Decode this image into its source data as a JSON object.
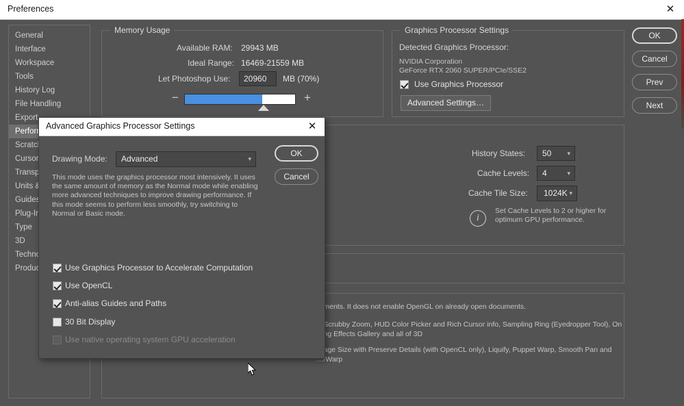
{
  "window": {
    "title": "Preferences",
    "close_icon": "close-icon",
    "close_glyph": "✕"
  },
  "sidebar": {
    "items": [
      {
        "label": "General",
        "selected": false
      },
      {
        "label": "Interface",
        "selected": false
      },
      {
        "label": "Workspace",
        "selected": false
      },
      {
        "label": "Tools",
        "selected": false
      },
      {
        "label": "History Log",
        "selected": false
      },
      {
        "label": "File Handling",
        "selected": false
      },
      {
        "label": "Export",
        "selected": false
      },
      {
        "label": "Performance",
        "selected": true
      },
      {
        "label": "Scratch Disks",
        "selected": false
      },
      {
        "label": "Cursors",
        "selected": false
      },
      {
        "label": "Transparency & Gamut",
        "selected": false
      },
      {
        "label": "Units & Rulers",
        "selected": false
      },
      {
        "label": "Guides, Grid & Slices",
        "selected": false
      },
      {
        "label": "Plug-Ins",
        "selected": false
      },
      {
        "label": "Type",
        "selected": false
      },
      {
        "label": "3D",
        "selected": false
      },
      {
        "label": "Technology Previews",
        "selected": false
      },
      {
        "label": "Product Improvement",
        "selected": false
      }
    ]
  },
  "memory_usage": {
    "group_title": "Memory Usage",
    "available_ram_label": "Available RAM:",
    "available_ram_value": "29943 MB",
    "ideal_range_label": "Ideal Range:",
    "ideal_range_value": "16469-21559 MB",
    "let_use_label": "Let Photoshop Use:",
    "let_use_value": "20960",
    "let_use_suffix": "MB (70%)",
    "slider_minus": "−",
    "slider_plus": "+",
    "slider_percent": 70
  },
  "graphics_processor": {
    "group_title": "Graphics Processor Settings",
    "detected_label": "Detected Graphics Processor:",
    "vendor": "NVIDIA Corporation",
    "model": "GeForce RTX 2060 SUPER/PCIe/SSE2",
    "use_gpu_label": "Use Graphics Processor",
    "use_gpu_checked": true,
    "advanced_button": "Advanced Settings…"
  },
  "history_cache": {
    "history_states_label": "History States:",
    "history_states_value": "50",
    "cache_levels_label": "Cache Levels:",
    "cache_levels_value": "4",
    "cache_tile_label": "Cache Tile Size:",
    "cache_tile_value": "1024K",
    "info_icon": "info-icon",
    "info_glyph": "i",
    "info_line1": "Set Cache Levels to 2 or higher for",
    "info_line2": "optimum GPU performance."
  },
  "description_panel": {
    "line1": "…ments. It does not enable OpenGL on already open documents.",
    "line2": "…Scrubby Zoom, HUD Color Picker and Rich Cursor info, Sampling Ring (Eyedropper Tool), On",
    "line3": "…ng Effects Gallery and all of 3D",
    "line4": "…age Size with Preserve Details (with OpenCL only), Liquify, Puppet Warp, Smooth Pan and",
    "line5": "…/Warp"
  },
  "side_buttons": {
    "ok": "OK",
    "cancel": "Cancel",
    "prev": "Prev",
    "next": "Next"
  },
  "modal": {
    "title": "Advanced Graphics Processor Settings",
    "close_icon": "close-icon",
    "close_glyph": "✕",
    "drawing_mode_label": "Drawing Mode:",
    "drawing_mode_value": "Advanced",
    "drawing_mode_arrow": "∨",
    "description": "This mode uses the graphics processor most intensively.  It uses the same amount of memory as the Normal mode while enabling more advanced techniques to improve drawing performance.  If this mode seems to perform less smoothly, try switching to Normal or Basic mode.",
    "ok": "OK",
    "cancel": "Cancel",
    "checkboxes": [
      {
        "label": "Use Graphics Processor to Accelerate Computation",
        "checked": true,
        "disabled": false
      },
      {
        "label": "Use OpenCL",
        "checked": true,
        "disabled": false
      },
      {
        "label": "Anti-alias Guides and Paths",
        "checked": true,
        "disabled": false
      },
      {
        "label": "30 Bit Display",
        "checked": false,
        "disabled": false
      },
      {
        "label": "Use native operating system GPU acceleration",
        "checked": false,
        "disabled": true
      }
    ]
  },
  "colors": {
    "accent_blue": "#4a90e2",
    "window_bg": "#535353",
    "titlebar_bg": "#ffffff",
    "selected_item": "#6e6e6e"
  }
}
